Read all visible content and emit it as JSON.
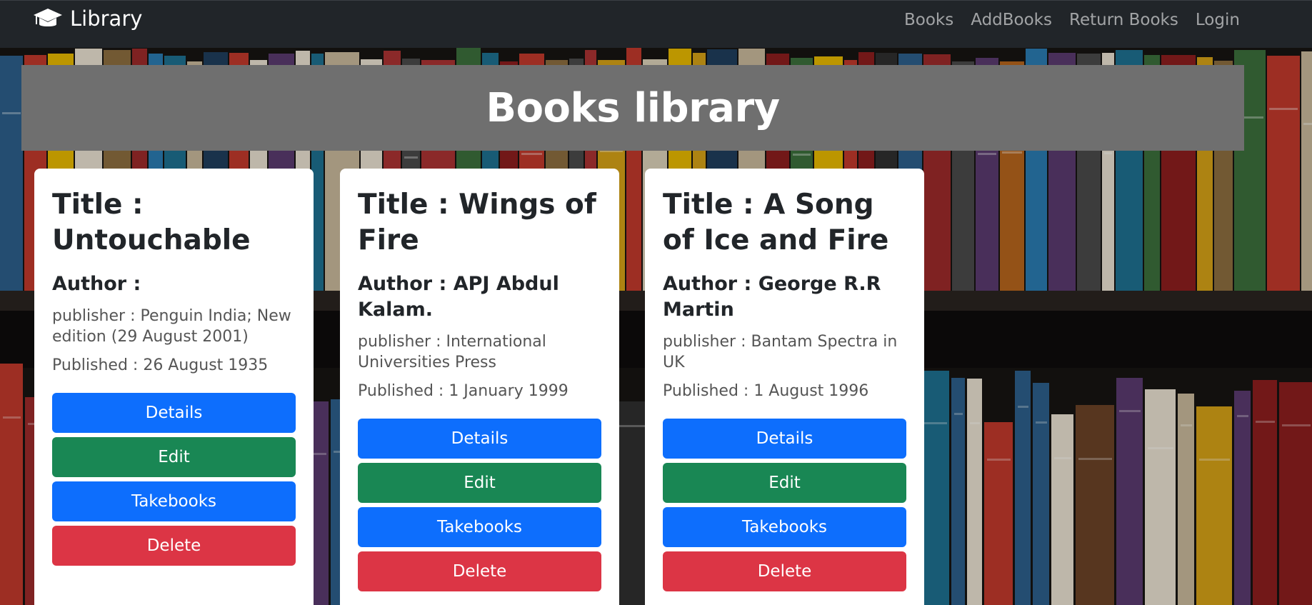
{
  "navbar": {
    "brand": "Library",
    "links": [
      "Books",
      "AddBooks",
      "Return Books",
      "Login"
    ]
  },
  "hero": {
    "title": "Books library"
  },
  "cards": [
    {
      "title": "Title : Untouchable",
      "author": "Author :",
      "publisher": "publisher : Penguin India; New edition (29 August 2001)",
      "published": "Published : 26 August 1935"
    },
    {
      "title": "Title : Wings of Fire",
      "author": "Author : APJ Abdul Kalam.",
      "publisher": "publisher : International Universities Press",
      "published": "Published : 1 January 1999"
    },
    {
      "title": "Title : A Song of Ice and Fire",
      "author": "Author : George R.R Martin",
      "publisher": "publisher : Bantam Spectra in UK",
      "published": "Published : 1 August 1996"
    }
  ],
  "buttons": {
    "details": "Details",
    "edit": "Edit",
    "takebooks": "Takebooks",
    "delete": "Delete"
  },
  "colors": {
    "navbar": "#212529",
    "hero": "#6f6f6f",
    "primary": "#0d6efd",
    "success": "#198754",
    "danger": "#dc3545"
  },
  "icons": {
    "brand": "graduation-cap-icon"
  }
}
